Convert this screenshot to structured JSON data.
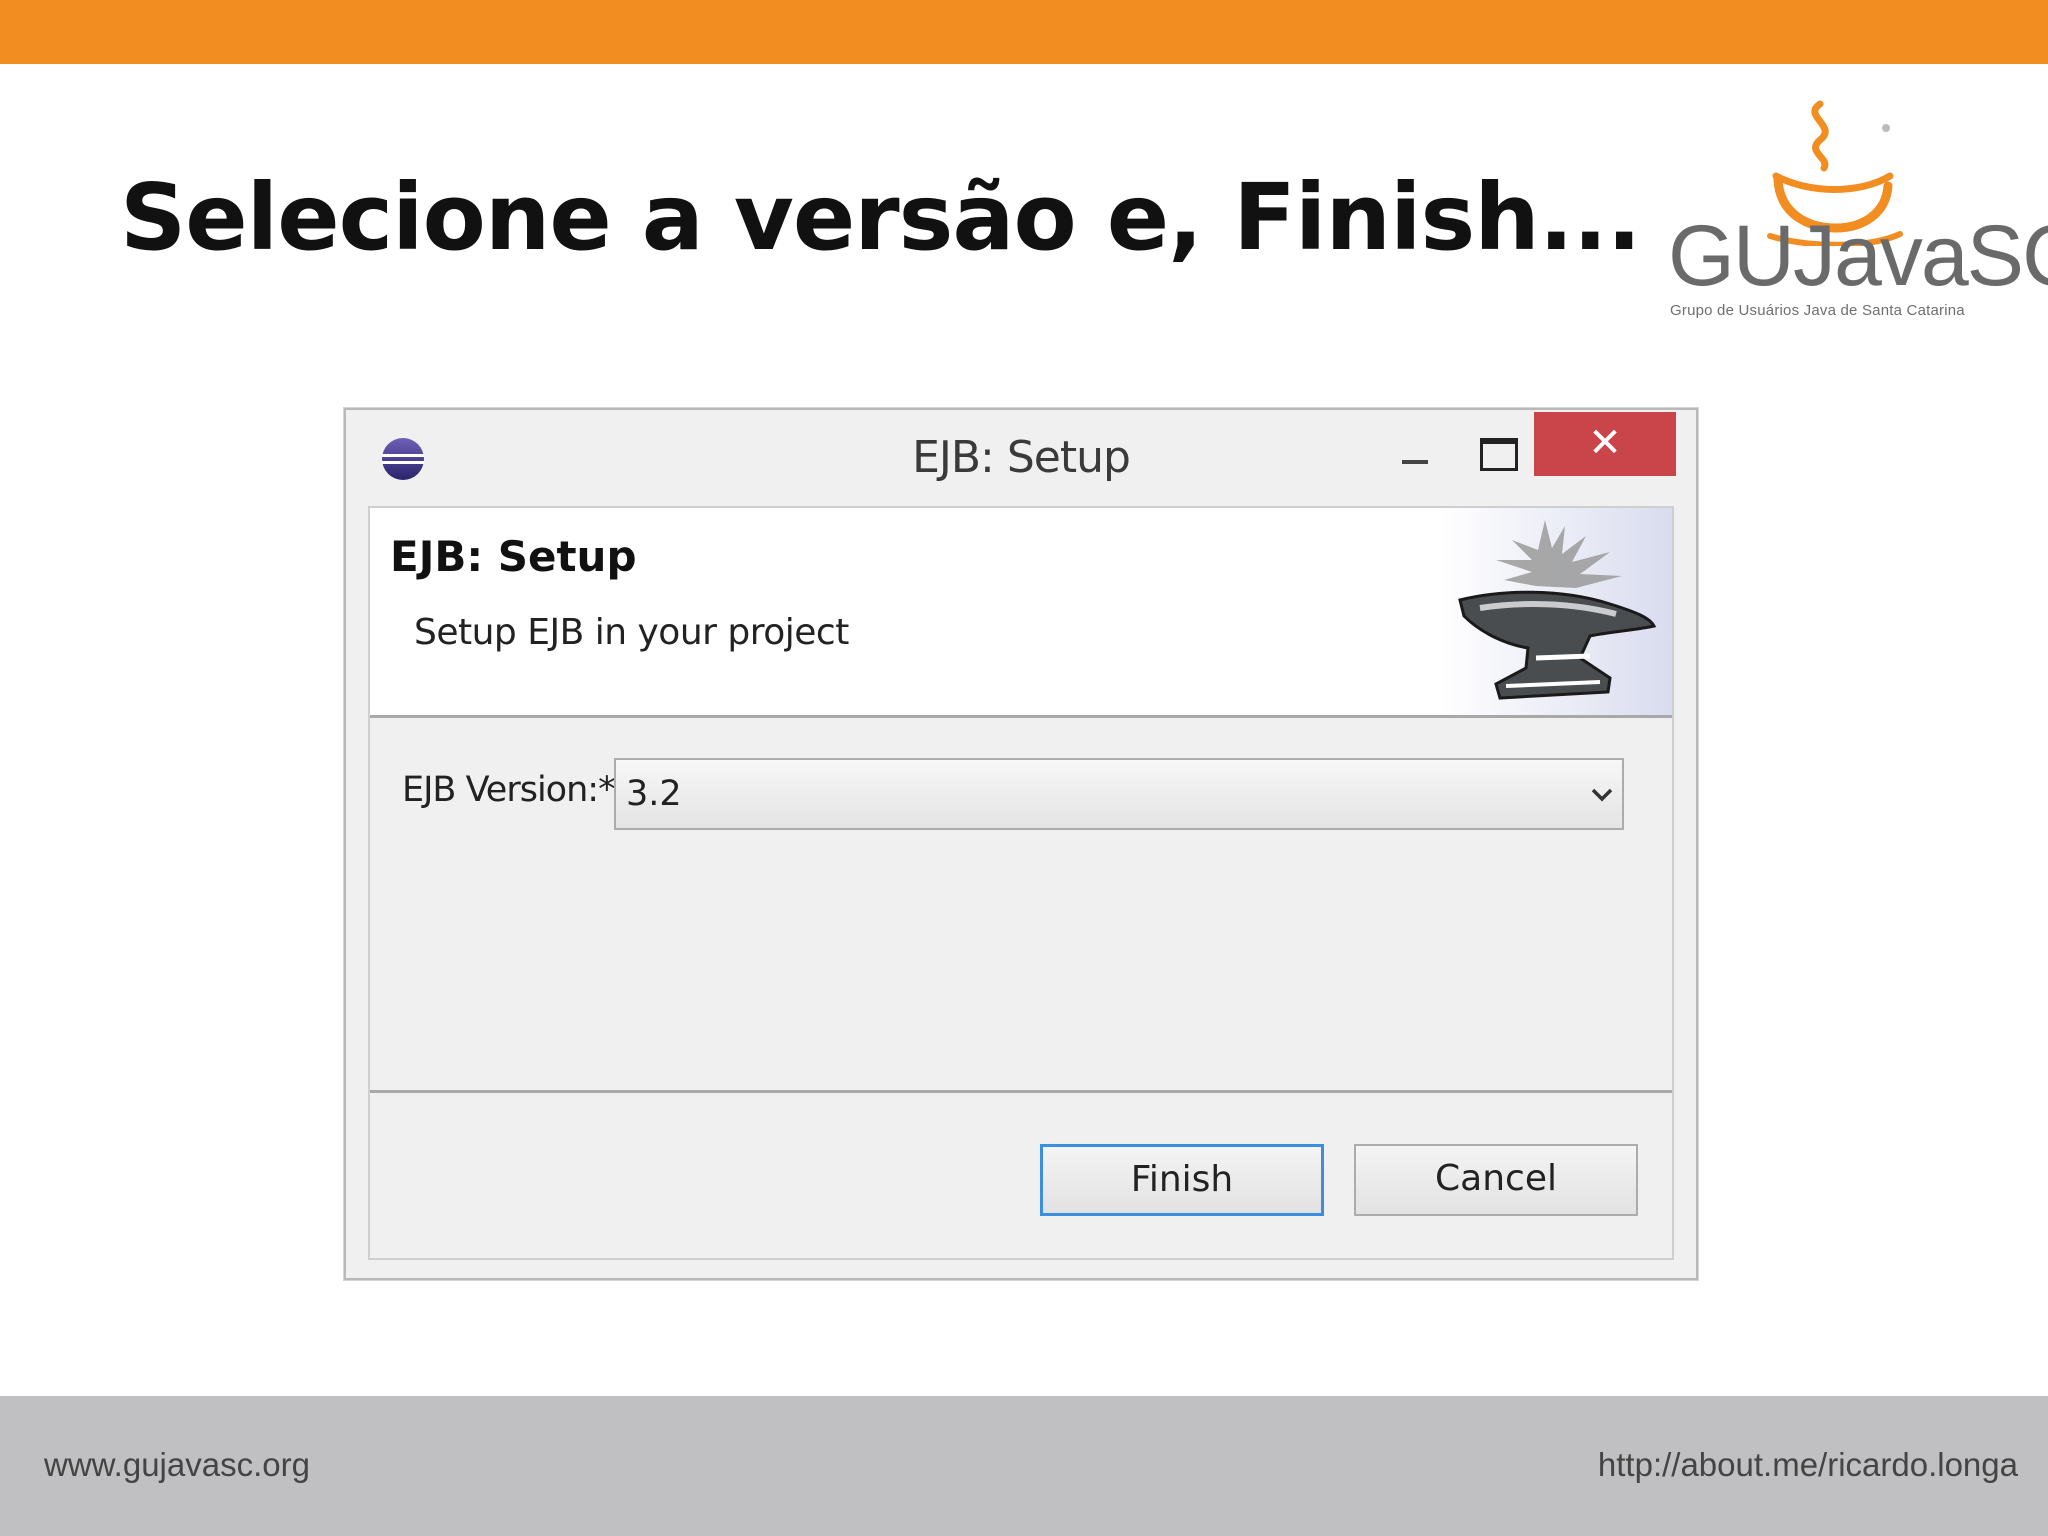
{
  "slide": {
    "title": "Selecione a versão e, Finish...",
    "logo": {
      "name": "GUJavaSC",
      "subtitle": "Grupo de Usuários Java de Santa Catarina"
    },
    "footer": {
      "left": "www.gujavasc.org",
      "right": "http://about.me/ricardo.longa"
    },
    "colors": {
      "top_bar": "#f28d22",
      "footer": "#c0c0c2"
    }
  },
  "dialog": {
    "window_title": "EJB: Setup",
    "close_glyph": "✕",
    "banner": {
      "title": "EJB: Setup",
      "description": "Setup EJB in your project",
      "icon": "anvil-icon"
    },
    "version": {
      "label": "EJB Version:*",
      "selected": "3.2"
    },
    "buttons": {
      "finish": "Finish",
      "cancel": "Cancel"
    }
  }
}
